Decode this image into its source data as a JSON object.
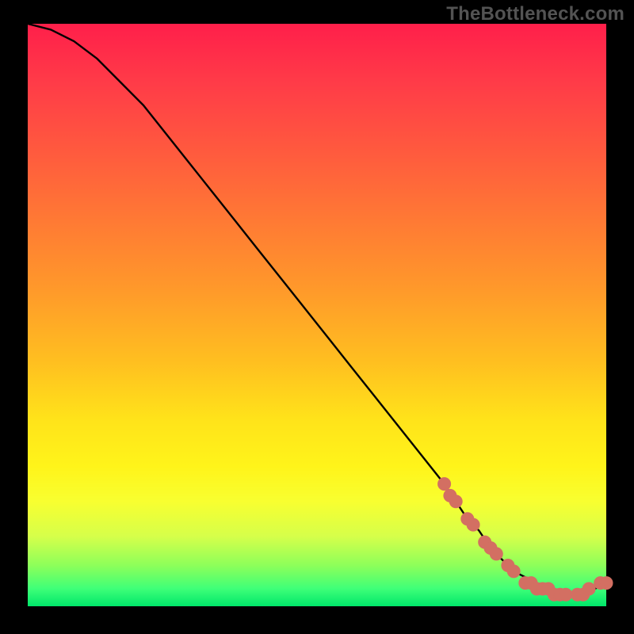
{
  "watermark": "TheBottleneck.com",
  "colors": {
    "frame_bg": "#000000",
    "watermark_text": "#535353",
    "curve_stroke": "#000000",
    "dot_fill": "#d36f62",
    "gradient_stops": [
      "#ff1f4a",
      "#ff5a3e",
      "#ff9a2a",
      "#ffe31a",
      "#d6ff4a",
      "#00e66a"
    ]
  },
  "chart_data": {
    "type": "line",
    "title": "",
    "xlabel": "",
    "ylabel": "",
    "xlim": [
      0,
      100
    ],
    "ylim": [
      0,
      100
    ],
    "series": [
      {
        "name": "bottleneck-curve",
        "x": [
          0,
          4,
          8,
          12,
          16,
          20,
          24,
          28,
          32,
          36,
          40,
          44,
          48,
          52,
          56,
          60,
          64,
          68,
          72,
          74,
          76,
          78,
          80,
          82,
          84,
          86,
          88,
          90,
          92,
          94,
          96,
          98,
          100
        ],
        "y": [
          100,
          99,
          97,
          94,
          90,
          86,
          81,
          76,
          71,
          66,
          61,
          56,
          51,
          46,
          41,
          36,
          31,
          26,
          21,
          18,
          15,
          13,
          10,
          8,
          6,
          5,
          4,
          3,
          2,
          2,
          2,
          3,
          4
        ]
      }
    ],
    "markers": [
      {
        "x": 72,
        "y": 21
      },
      {
        "x": 73,
        "y": 19
      },
      {
        "x": 74,
        "y": 18
      },
      {
        "x": 76,
        "y": 15
      },
      {
        "x": 77,
        "y": 14
      },
      {
        "x": 79,
        "y": 11
      },
      {
        "x": 80,
        "y": 10
      },
      {
        "x": 81,
        "y": 9
      },
      {
        "x": 83,
        "y": 7
      },
      {
        "x": 84,
        "y": 6
      },
      {
        "x": 86,
        "y": 4
      },
      {
        "x": 87,
        "y": 4
      },
      {
        "x": 88,
        "y": 3
      },
      {
        "x": 89,
        "y": 3
      },
      {
        "x": 90,
        "y": 3
      },
      {
        "x": 91,
        "y": 2
      },
      {
        "x": 92,
        "y": 2
      },
      {
        "x": 93,
        "y": 2
      },
      {
        "x": 95,
        "y": 2
      },
      {
        "x": 96,
        "y": 2
      },
      {
        "x": 97,
        "y": 3
      },
      {
        "x": 99,
        "y": 4
      },
      {
        "x": 100,
        "y": 4
      }
    ]
  }
}
